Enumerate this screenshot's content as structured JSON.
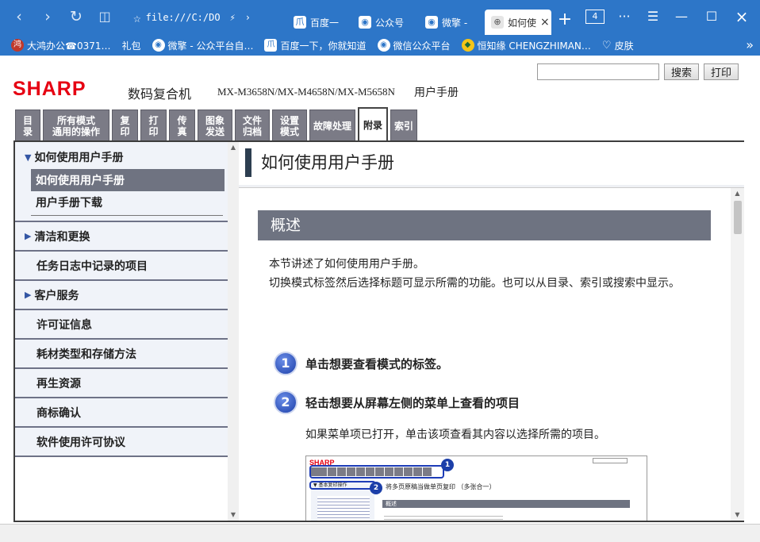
{
  "browser": {
    "address": "file:///C:/DO",
    "tabs": [
      {
        "label": "百度一",
        "icon": "爪"
      },
      {
        "label": "公众号",
        "icon": "◉"
      },
      {
        "label": "微擎 -",
        "icon": "◉"
      },
      {
        "label": "如何使",
        "icon": "⊕",
        "active": true
      }
    ],
    "tab_count": "4",
    "bookmarks": [
      {
        "label": "大鸿办公☎0371…",
        "icon": "鸿"
      },
      {
        "label": "礼包",
        "icon": ""
      },
      {
        "label": "微擎 - 公众平台自…",
        "icon": "◉"
      },
      {
        "label": "百度一下，你就知道",
        "icon": "爪"
      },
      {
        "label": "微信公众平台",
        "icon": "◉"
      },
      {
        "label": "恒知缘 CHENGZHIMAN…",
        "icon": "◆"
      },
      {
        "label": "皮肤",
        "icon": "♡"
      }
    ]
  },
  "header": {
    "search_placeholder": "",
    "search_button": "搜索",
    "print_button": "打印",
    "logo": "SHARP",
    "product_name": "数码复合机",
    "models": "MX-M3658N/MX-M4658N/MX-M5658N",
    "manual": "用户手册"
  },
  "mode_tabs": [
    {
      "label": "目录",
      "width": 32
    },
    {
      "label": "所有模式\n通用的操作",
      "width": 84
    },
    {
      "label": "复印",
      "width": 33
    },
    {
      "label": "打印",
      "width": 33
    },
    {
      "label": "传真",
      "width": 33
    },
    {
      "label": "图象\n发送",
      "width": 44
    },
    {
      "label": "文件\n归档",
      "width": 44
    },
    {
      "label": "设置\n模式",
      "width": 44
    },
    {
      "label": "故障处理",
      "width": 58
    },
    {
      "label": "附录",
      "width": 38,
      "active": true
    },
    {
      "label": "索引",
      "width": 34
    }
  ],
  "sidebar": {
    "group_title": "如何使用用户手册",
    "sub_items": [
      {
        "label": "如何使用用户手册",
        "active": true
      },
      {
        "label": "用户手册下载",
        "active": false
      }
    ],
    "items": [
      {
        "label": "清洁和更换",
        "arrow": true
      },
      {
        "label": "任务日志中记录的项目",
        "arrow": false
      },
      {
        "label": "客户服务",
        "arrow": true
      },
      {
        "label": "许可证信息",
        "arrow": false
      },
      {
        "label": "耗材类型和存储方法",
        "arrow": false
      },
      {
        "label": "再生资源",
        "arrow": false
      },
      {
        "label": "商标确认",
        "arrow": false
      },
      {
        "label": "软件使用许可协议",
        "arrow": false
      }
    ]
  },
  "content": {
    "title": "如何使用用户手册",
    "section": "概述",
    "intro_1": "本节讲述了如何使用用户手册。",
    "intro_2": "切换模式标签然后选择标题可显示所需的功能。也可以从目录、索引或搜索中显示。",
    "step1_num": "1",
    "step1": "单击想要查看模式的标签。",
    "step2_num": "2",
    "step2": "轻击想要从屏幕左侧的菜单上查看的项目",
    "step2_desc": "如果菜单项已打开，单击该项查看其内容以选择所需的项目。",
    "preview": {
      "logo": "SHARP",
      "menu_item": "▼ 基本复印操作",
      "title": "将多页原稿当做单页复印  （多张合一）",
      "bar": "概述",
      "n1": "1",
      "n2": "2"
    }
  }
}
